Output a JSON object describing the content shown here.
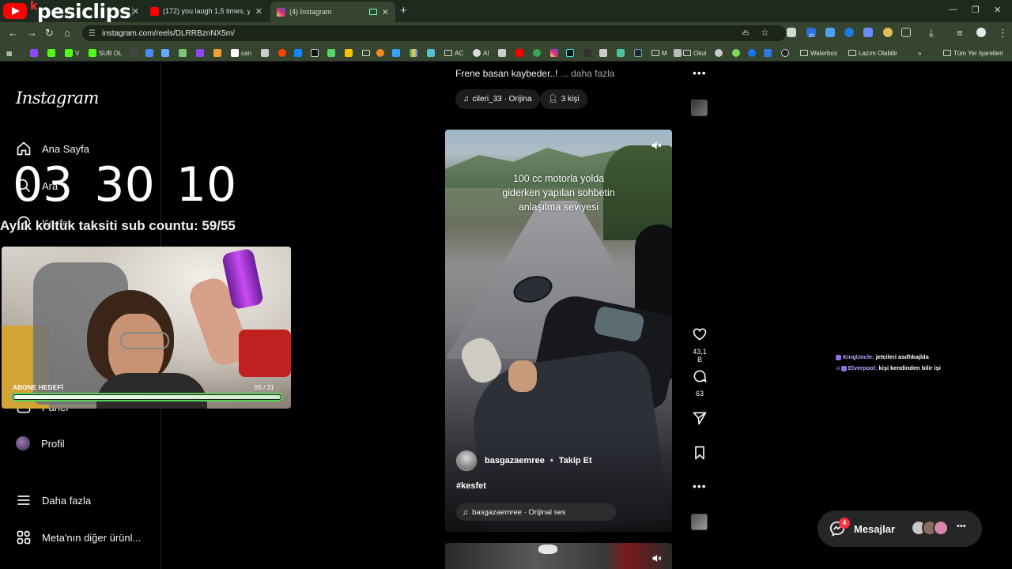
{
  "channel_logo": {
    "text": "pesiclips",
    "prefix": "k"
  },
  "tabs": [
    {
      "title": "(172) you laugh 1,5 times, you",
      "icon_color": "#ff0000",
      "active": false
    },
    {
      "title": "(4) Instagram",
      "icon_color": "#d6249f",
      "active": true
    }
  ],
  "address_bar": {
    "url": "instagram.com/reels/DLRRBznNX5m/"
  },
  "extension_badge": "20",
  "bookmarks": [
    {
      "label": "SUB OL",
      "color": "#53fc18"
    },
    {
      "label": "can",
      "color": "#ffffff"
    },
    {
      "label": "AC",
      "folder": true
    },
    {
      "label": "AI",
      "color": "#d0d0d0"
    },
    {
      "label": "M",
      "folder": true
    },
    {
      "label": "Okul",
      "folder": true
    },
    {
      "label": "Waterbox",
      "folder": true
    },
    {
      "label": "Lazım Olabilir",
      "folder": true
    },
    {
      "label": "Tüm Yer İşaretleri",
      "folder": true
    }
  ],
  "sidebar": {
    "logo": "Instagram",
    "items": [
      {
        "label": "Ana Sayfa",
        "icon": "home-icon"
      },
      {
        "label": "Ara",
        "icon": "search-icon"
      },
      {
        "label": "Keşfet",
        "icon": "compass-icon"
      },
      {
        "label": "Panel",
        "icon": "panel-icon"
      },
      {
        "label": "Profil",
        "icon": "profile-avatar"
      },
      {
        "label": "Daha fazla",
        "icon": "menu-icon"
      },
      {
        "label": "Meta'nın diğer ürünl...",
        "icon": "meta-apps-icon"
      }
    ]
  },
  "stream_overlay": {
    "timer": "03 30 10",
    "sub_count_text": "Aylık koltuk taksiti sub countu: 59/55",
    "goal_label": "ABONE HEDEFİ",
    "goal_value": "55 / 31",
    "goal_fraction": 1.0
  },
  "previous_reel": {
    "caption": "Frene basan kaybeder..!",
    "more_label": "... daha fazla",
    "audio_label": "cileri_33 · Orijina",
    "people_label": "3 kişi"
  },
  "reel": {
    "overlay_lines": [
      "100 cc motorla yolda",
      "giderken yapılan sohbetin",
      "anlaşılma seviyesi"
    ],
    "author": "basgazaemree",
    "follow_label": "Takip Et",
    "hashtag": "#kesfet",
    "audio": "basgazaemree · Orijinal ses",
    "likes": "43,1 B",
    "comments": "63"
  },
  "chat": [
    {
      "user": "KingUncle:",
      "message": "jetcileri asdhkajlda"
    },
    {
      "user": "Elverpool:",
      "message": "kişi kendinden bilir işi"
    }
  ],
  "messages": {
    "label": "Mesajlar",
    "badge": "4"
  },
  "colors": {
    "accent_green": "#5ad25a",
    "like_red": "#ff3040",
    "chrome_bg": "#35452f"
  }
}
